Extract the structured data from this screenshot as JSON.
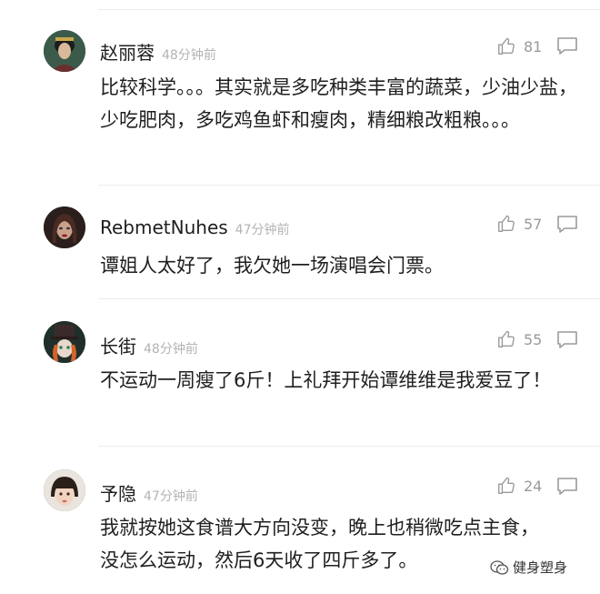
{
  "comments": [
    {
      "name": "赵丽蓉",
      "time": "48分钟前",
      "likes": "81",
      "text": "比较科学。。。其实就是多吃种类丰富的蔬菜，少油少盐，少吃肥肉，多吃鸡鱼虾和瘦肉，精细粮改粗粮。。。",
      "avatar_icon": "portrait-woman-icon"
    },
    {
      "name": "RebmetNuhes",
      "time": "47分钟前",
      "likes": "57",
      "text": "谭姐人太好了，我欠她一场演唱会门票。",
      "avatar_icon": "portrait-dark-hair-icon"
    },
    {
      "name": "长街",
      "time": "48分钟前",
      "likes": "55",
      "text": "不运动一周瘦了6斤！上礼拜开始谭维维是我爱豆了！",
      "avatar_icon": "mad-hatter-icon"
    },
    {
      "name": "予隐",
      "time": "47分钟前",
      "likes": "24",
      "text": "我就按她这食谱大方向没变，晚上也稍微吃点主食，没怎么运动，然后6天收了四斤多了。",
      "avatar_icon": "portrait-child-icon"
    }
  ],
  "watermark": {
    "label": "健身塑身",
    "icon": "wechat-icon"
  },
  "colors": {
    "like_gray": "#9a9a9a",
    "time_gray": "#b3b3b3",
    "divider": "#ececec"
  }
}
